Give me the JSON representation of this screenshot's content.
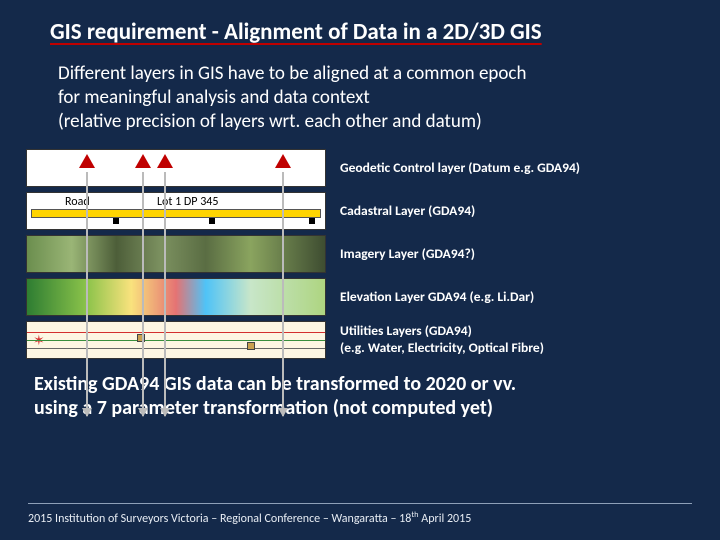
{
  "title": "GIS requirement - Alignment of Data in a 2D/3D GIS",
  "intro_l1": "Different layers in GIS have to be aligned at a common epoch",
  "intro_l2": "for meaningful analysis and data context",
  "intro_l3": "(relative precision of layers wrt. each other and datum)",
  "layers": {
    "geodetic": "Geodetic Control layer (Datum e.g. GDA94)",
    "cadastral": "Cadastral Layer (GDA94)",
    "cadastral_road": "Road",
    "cadastral_lot": "Lot 1 DP 345",
    "imagery": "Imagery Layer (GDA94?)",
    "elevation": "Elevation Layer GDA94 (e.g. Li.Dar)",
    "utilities_l1": "Utilities Layers (GDA94)",
    "utilities_l2": "(e.g. Water, Electricity, Optical Fibre)"
  },
  "conclusion_l1": "Existing GDA94 GIS data can be transformed to 2020 or vv.",
  "conclusion_l2": "using a 7 parameter transformation (not computed yet)",
  "footer_pre": "2015 Institution of Surveyors Victoria – Regional Conference – Wangaratta – 18",
  "footer_post": " April 2015",
  "footer_sup": "th"
}
